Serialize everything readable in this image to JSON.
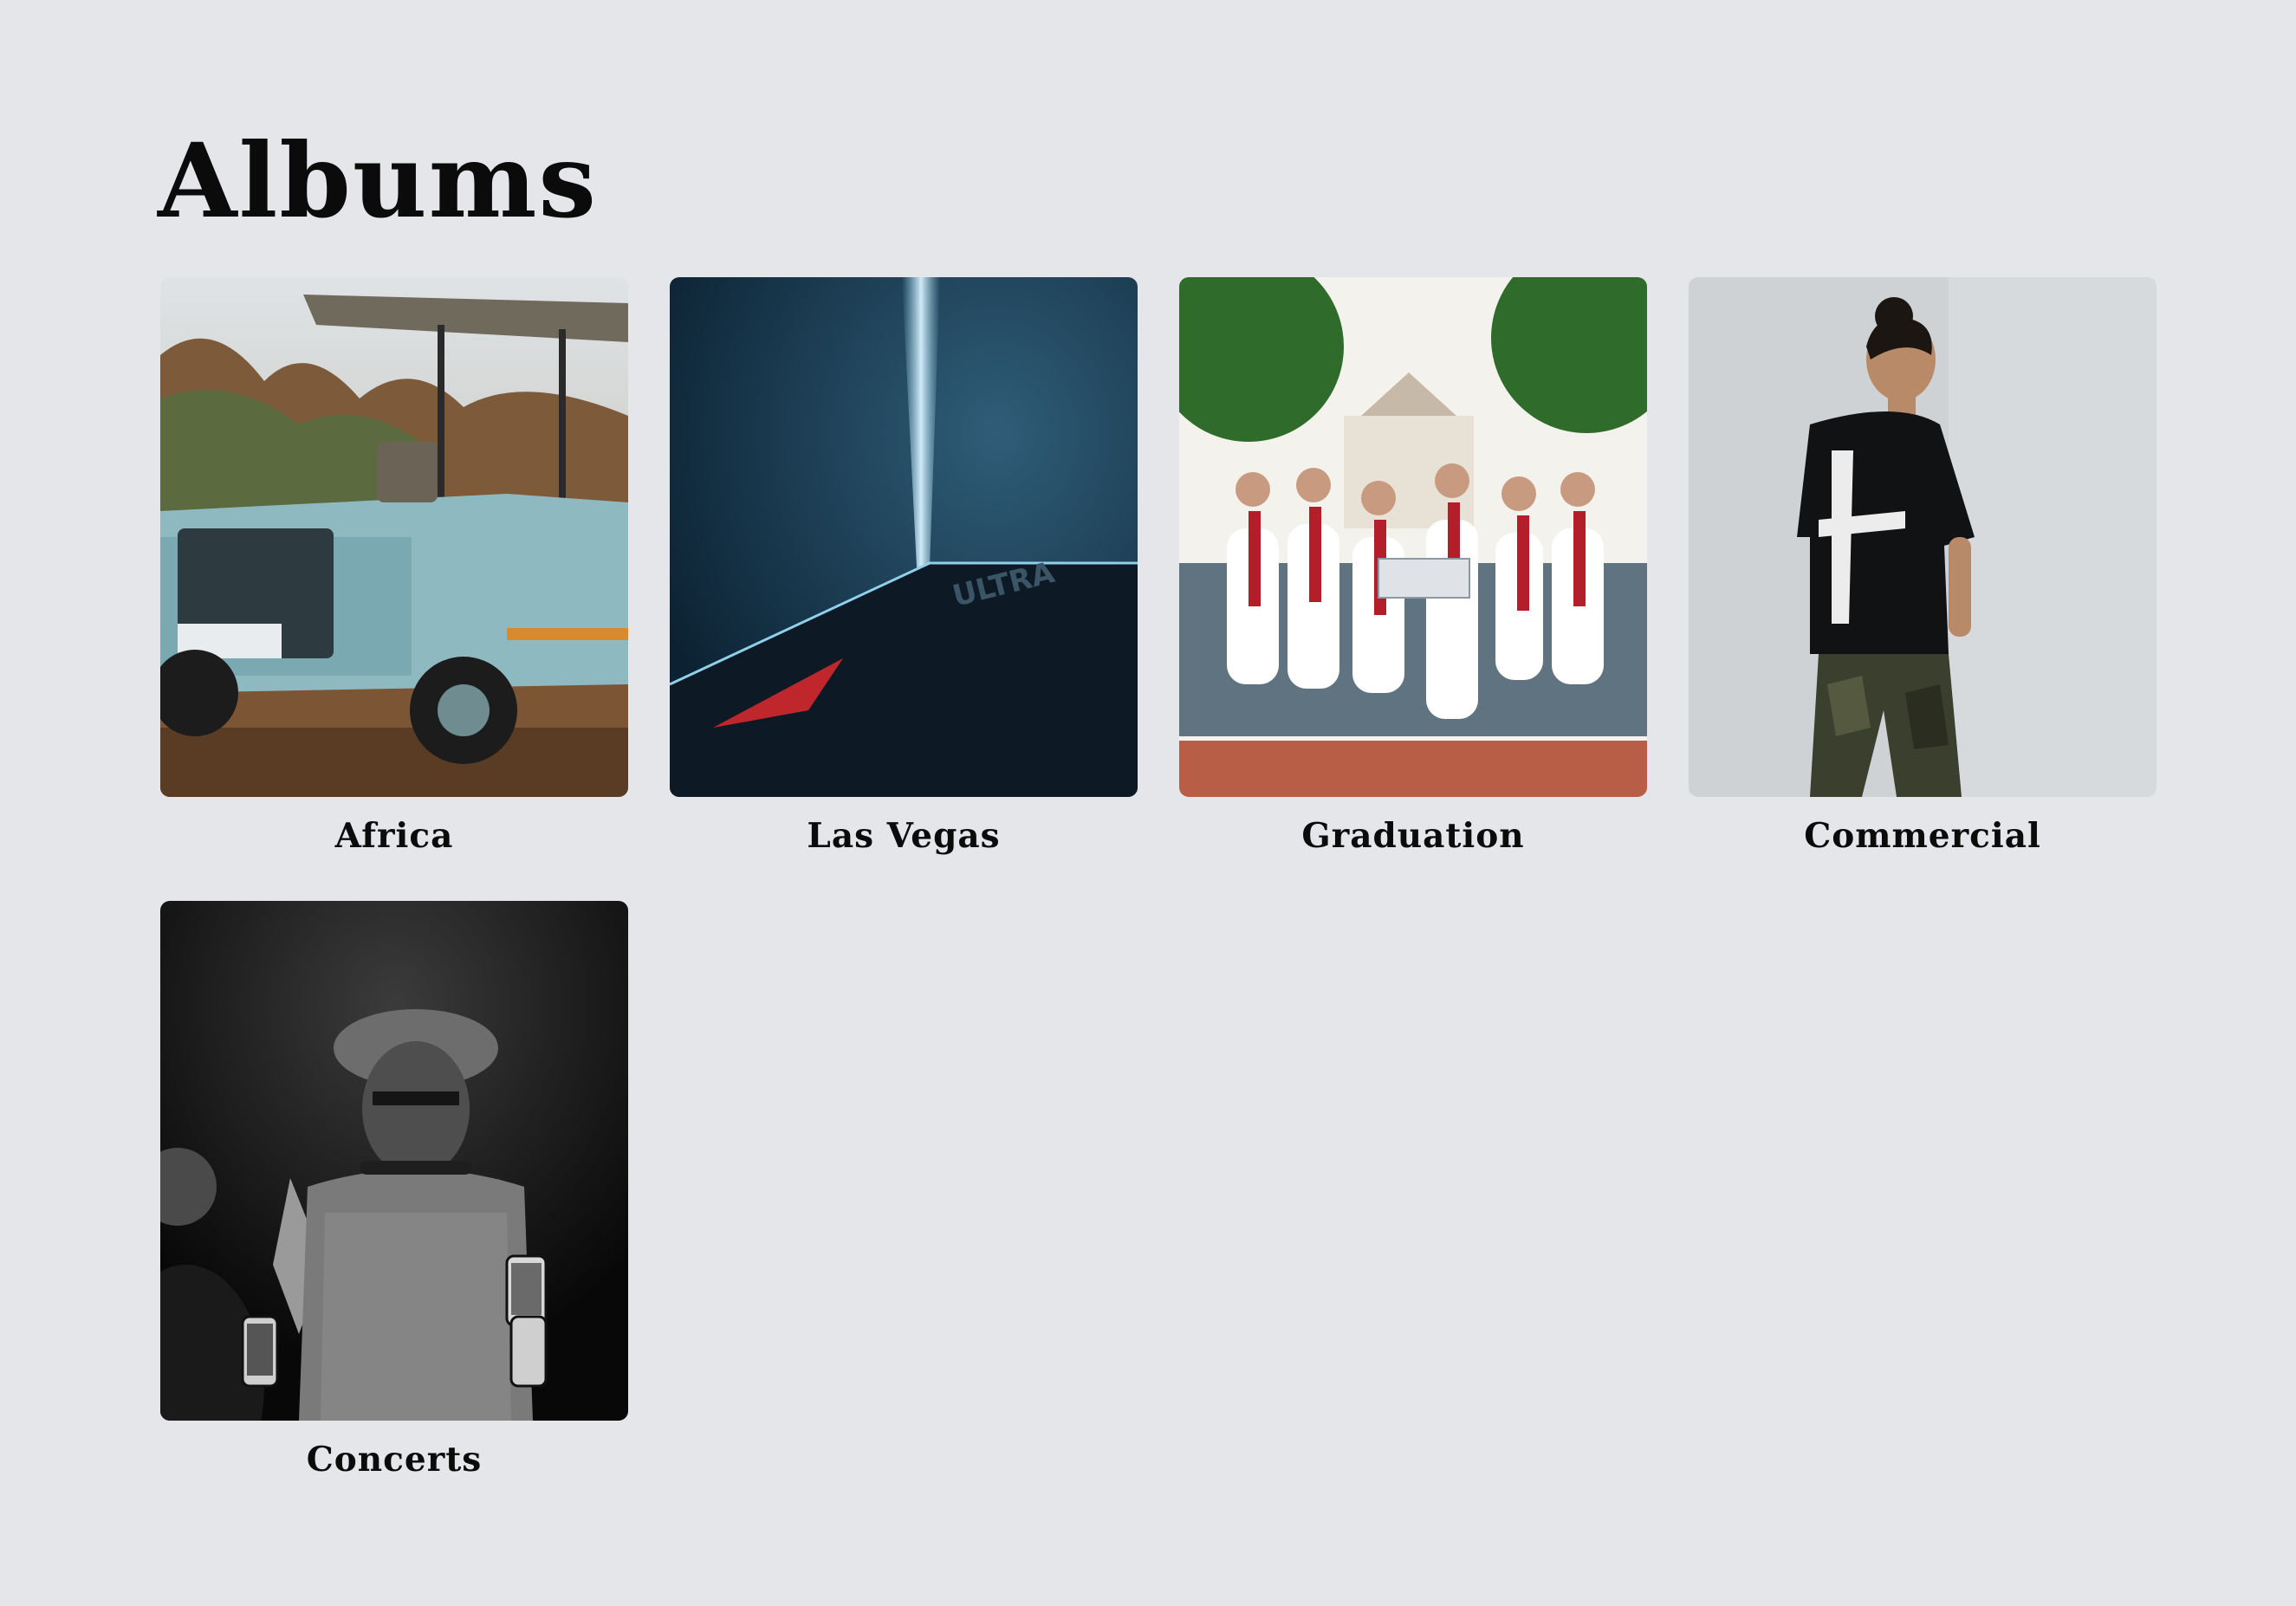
{
  "page": {
    "title": "Albums",
    "background": "#e5e6e9"
  },
  "albums": [
    {
      "label": "Africa"
    },
    {
      "label": "Las Vegas"
    },
    {
      "label": "Graduation"
    },
    {
      "label": "Commercial"
    },
    {
      "label": "Concerts"
    }
  ]
}
